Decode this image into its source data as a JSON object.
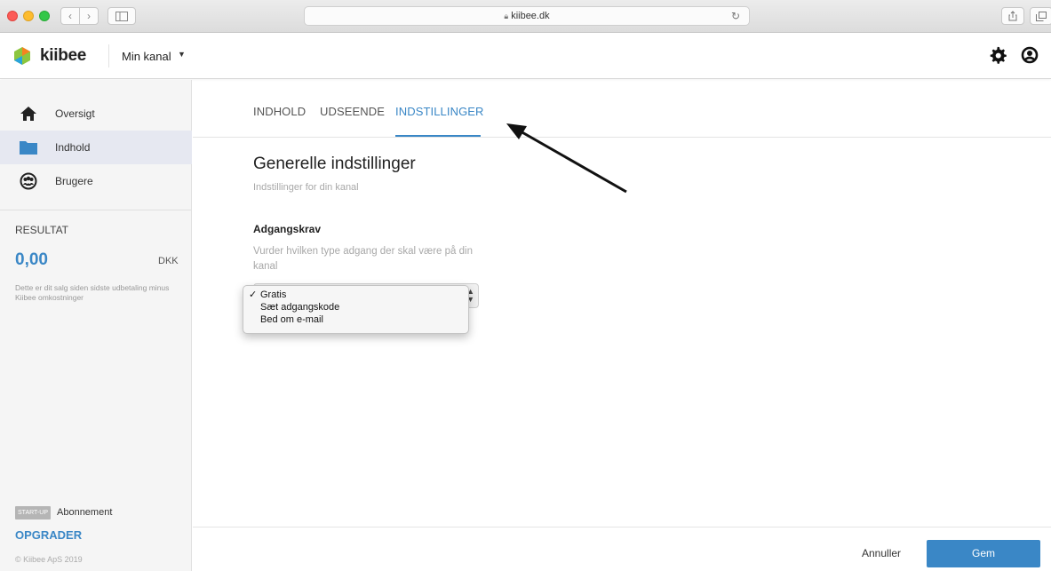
{
  "browser": {
    "url": "kiibee.dk",
    "nav_back": "‹",
    "nav_forward": "›"
  },
  "header": {
    "logo_text": "kiibee",
    "logo_letter": "k",
    "channel": "Min kanal",
    "colors": {
      "logo_green": "#8cc63e",
      "logo_orange": "#f58220",
      "logo_blue": "#29a3dc"
    }
  },
  "sidebar": {
    "items": [
      {
        "label": "Oversigt",
        "icon": "home-icon",
        "active": false
      },
      {
        "label": "Indhold",
        "icon": "folder-icon",
        "active": true
      },
      {
        "label": "Brugere",
        "icon": "users-icon",
        "active": false
      }
    ],
    "result": {
      "title": "RESULTAT",
      "value": "0,00",
      "currency": "DKK",
      "description": "Dette er dit salg siden sidste udbetaling minus Kiibee omkostninger"
    },
    "plan_badge": "START-UP",
    "plan_label": "Abonnement",
    "upgrade": "OPGRADER",
    "copyright": "© Kiibee ApS 2019"
  },
  "tabs": [
    {
      "label": "INDHOLD",
      "active": false
    },
    {
      "label": "UDSEENDE",
      "active": false
    },
    {
      "label": "INDSTILLINGER",
      "active": true
    }
  ],
  "settings": {
    "title": "Generelle indstillinger",
    "subtitle": "Indstillinger for din kanal",
    "access": {
      "label": "Adgangskrav",
      "description": "Vurder hvilken type adgang der skal være på din kanal",
      "selected": "Gratis",
      "options": [
        "Gratis",
        "Sæt adgangskode",
        "Bed om e-mail"
      ]
    }
  },
  "footer": {
    "cancel": "Annuller",
    "save": "Gem"
  },
  "colors": {
    "accent": "#3a87c6",
    "active_sidebar": "#e6e8f1"
  }
}
